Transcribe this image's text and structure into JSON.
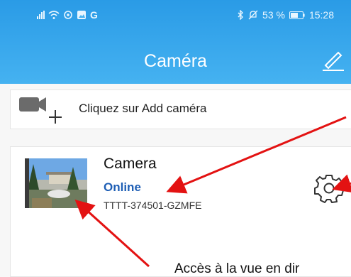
{
  "status_bar": {
    "left_icons": [
      "signal-icon",
      "wifi-icon",
      "sync-icon",
      "gallery-icon"
    ],
    "carrier": "G",
    "battery": "53 %",
    "time": "15:28"
  },
  "header": {
    "title": "Caméra"
  },
  "add_camera": {
    "label": "Cliquez sur Add caméra"
  },
  "camera": {
    "name": "Camera",
    "status": "Online",
    "id": "TTTT-374501-GZMFE"
  },
  "annotation": {
    "text": "Accès à la vue en dir"
  },
  "colors": {
    "header_top": "#2a9be6",
    "header_bottom": "#45b2f1",
    "status_online": "#1f5fb5",
    "annotation_arrow": "#e31212"
  }
}
